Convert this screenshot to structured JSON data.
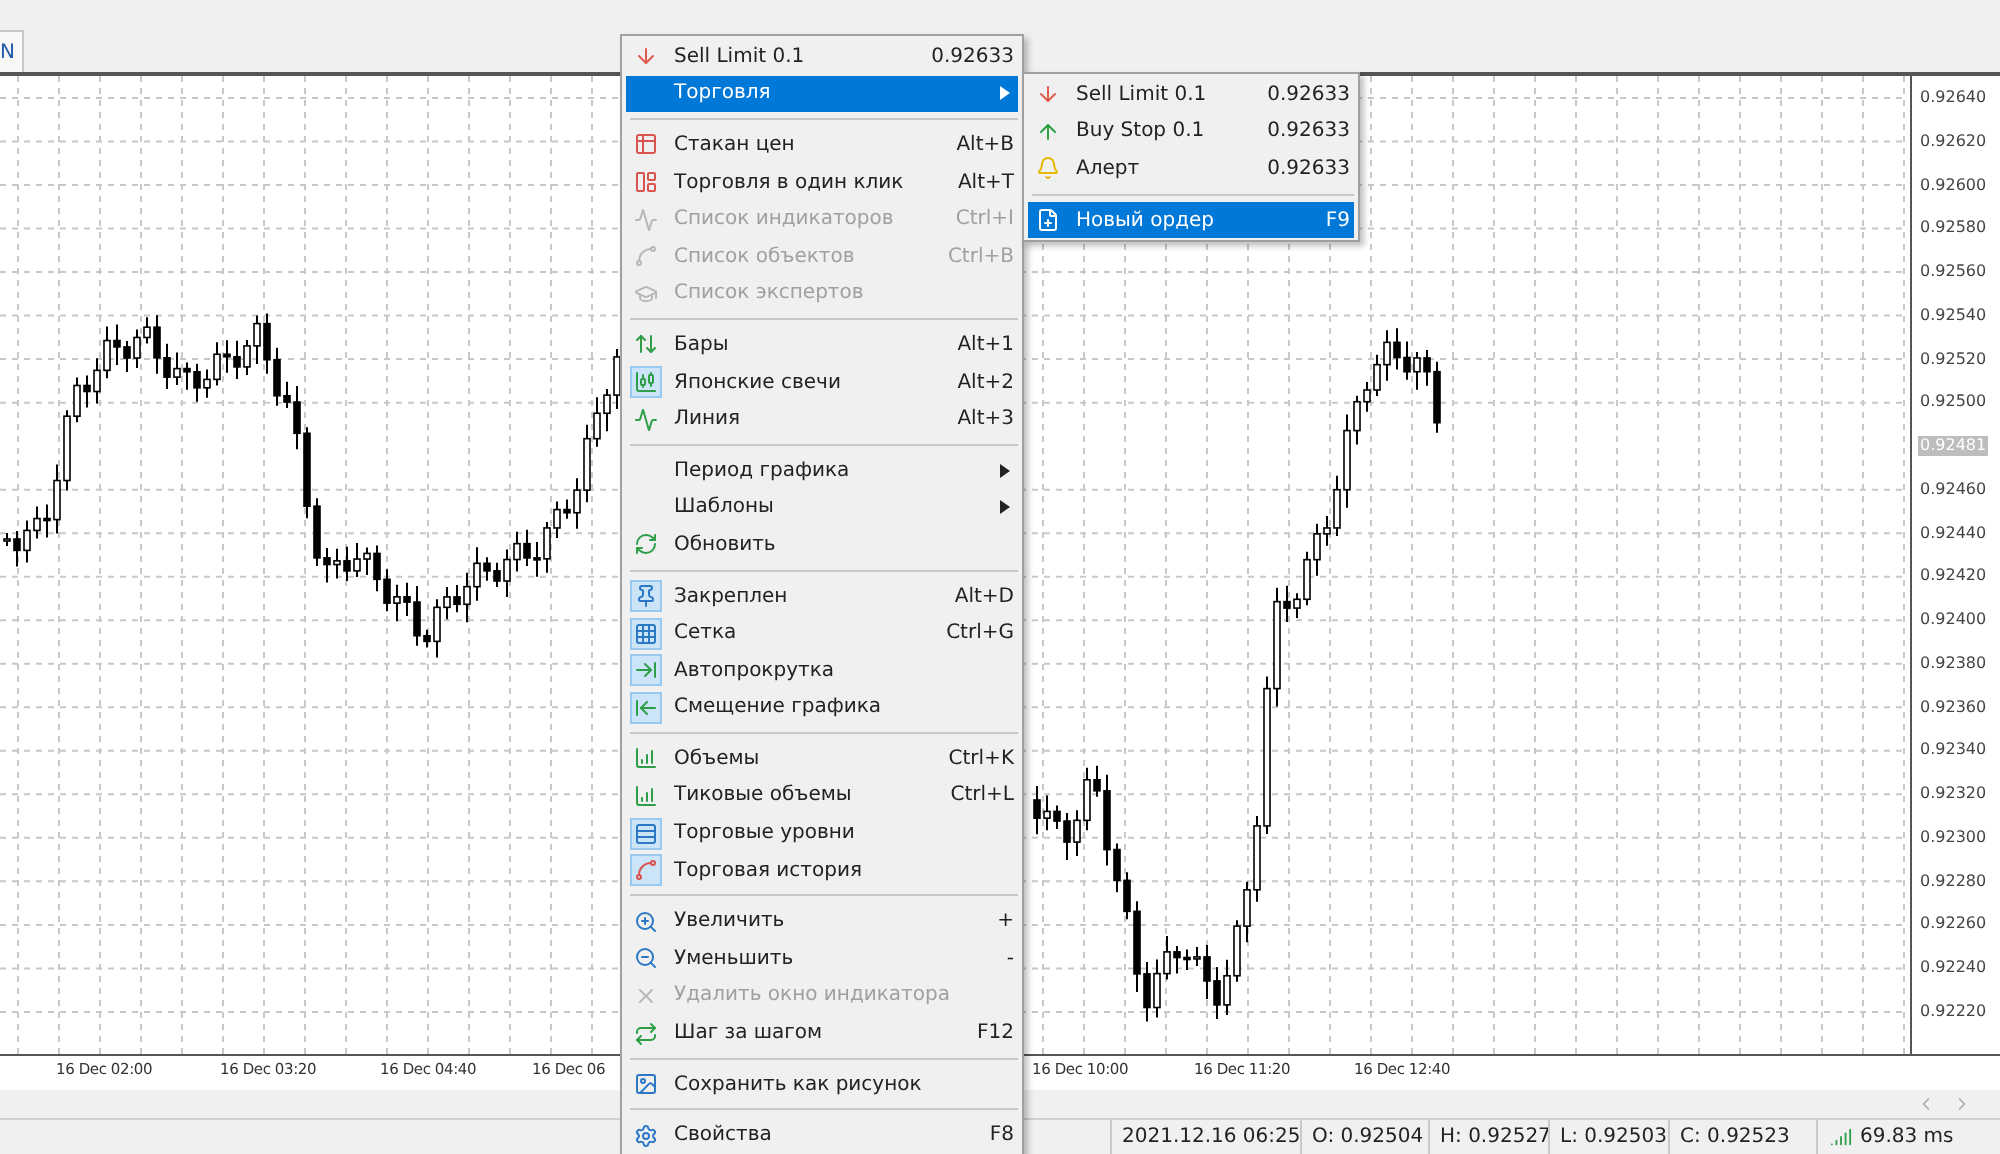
{
  "toolbar": {
    "tab": "N"
  },
  "chart": {
    "price_labels": [
      {
        "kind": "tick",
        "text": "0.92640"
      },
      {
        "kind": "tick",
        "text": "0.92620"
      },
      {
        "kind": "tick",
        "text": "0.92600"
      },
      {
        "kind": "tick",
        "text": "0.92580"
      },
      {
        "kind": "tick",
        "text": "0.92560"
      },
      {
        "kind": "tick",
        "text": "0.92540"
      },
      {
        "kind": "tick",
        "text": "0.92520"
      },
      {
        "kind": "tick",
        "text": "0.92500"
      },
      {
        "kind": "current",
        "text": "0.92481"
      },
      {
        "kind": "tick",
        "text": "0.92460"
      },
      {
        "kind": "tick",
        "text": "0.92440"
      },
      {
        "kind": "tick",
        "text": "0.92420"
      },
      {
        "kind": "tick",
        "text": "0.92400"
      },
      {
        "kind": "tick",
        "text": "0.92380"
      },
      {
        "kind": "tick",
        "text": "0.92360"
      },
      {
        "kind": "tick",
        "text": "0.92340"
      },
      {
        "kind": "tick",
        "text": "0.92320"
      },
      {
        "kind": "tick",
        "text": "0.92300"
      },
      {
        "kind": "tick",
        "text": "0.92280"
      },
      {
        "kind": "tick",
        "text": "0.92260"
      },
      {
        "kind": "tick",
        "text": "0.92240"
      },
      {
        "kind": "tick",
        "text": "0.92220"
      }
    ],
    "time_labels": [
      "16 Dec 02:00",
      "16 Dec 03:20",
      "16 Dec 04:40",
      "16 Dec 06",
      "16 Dec 10:00",
      "16 Dec 11:20",
      "16 Dec 12:40"
    ]
  },
  "context_menu": {
    "items": [
      {
        "kind": "item",
        "label": "Sell Limit 0.1",
        "shortcut": "0.92633",
        "selected": false,
        "disabled": false,
        "checked": false,
        "submenu": false
      },
      {
        "kind": "item",
        "label": "Торговля",
        "selected": true,
        "disabled": false,
        "checked": false,
        "submenu": true
      },
      {
        "kind": "separator"
      },
      {
        "kind": "item",
        "label": "Стакан цен",
        "shortcut": "Alt+B",
        "selected": false,
        "disabled": false,
        "checked": false,
        "submenu": false
      },
      {
        "kind": "item",
        "label": "Торговля в один клик",
        "shortcut": "Alt+T",
        "selected": false,
        "disabled": false,
        "checked": false,
        "submenu": false
      },
      {
        "kind": "item",
        "label": "Список индикаторов",
        "shortcut": "Ctrl+I",
        "selected": false,
        "disabled": true,
        "checked": false,
        "submenu": false
      },
      {
        "kind": "item",
        "label": "Список объектов",
        "shortcut": "Ctrl+B",
        "selected": false,
        "disabled": true,
        "checked": false,
        "submenu": false
      },
      {
        "kind": "item",
        "label": "Список экспертов",
        "selected": false,
        "disabled": true,
        "checked": false,
        "submenu": false
      },
      {
        "kind": "separator"
      },
      {
        "kind": "item",
        "label": "Бары",
        "shortcut": "Alt+1",
        "selected": false,
        "disabled": false,
        "checked": false,
        "submenu": false
      },
      {
        "kind": "item",
        "label": "Японские свечи",
        "shortcut": "Alt+2",
        "selected": false,
        "disabled": false,
        "checked": true,
        "submenu": false
      },
      {
        "kind": "item",
        "label": "Линия",
        "shortcut": "Alt+3",
        "selected": false,
        "disabled": false,
        "checked": false,
        "submenu": false
      },
      {
        "kind": "separator"
      },
      {
        "kind": "item",
        "label": "Период графика",
        "selected": false,
        "disabled": false,
        "checked": false,
        "submenu": true
      },
      {
        "kind": "item",
        "label": "Шаблоны",
        "selected": false,
        "disabled": false,
        "checked": false,
        "submenu": true
      },
      {
        "kind": "item",
        "label": "Обновить",
        "selected": false,
        "disabled": false,
        "checked": false,
        "submenu": false
      },
      {
        "kind": "separator"
      },
      {
        "kind": "item",
        "label": "Закреплен",
        "shortcut": "Alt+D",
        "selected": false,
        "disabled": false,
        "checked": true,
        "submenu": false
      },
      {
        "kind": "item",
        "label": "Сетка",
        "shortcut": "Ctrl+G",
        "selected": false,
        "disabled": false,
        "checked": true,
        "submenu": false
      },
      {
        "kind": "item",
        "label": "Автопрокрутка",
        "selected": false,
        "disabled": false,
        "checked": true,
        "submenu": false
      },
      {
        "kind": "item",
        "label": "Смещение графика",
        "selected": false,
        "disabled": false,
        "checked": true,
        "submenu": false
      },
      {
        "kind": "separator"
      },
      {
        "kind": "item",
        "label": "Объемы",
        "shortcut": "Ctrl+K",
        "selected": false,
        "disabled": false,
        "checked": false,
        "submenu": false
      },
      {
        "kind": "item",
        "label": "Тиковые объемы",
        "shortcut": "Ctrl+L",
        "selected": false,
        "disabled": false,
        "checked": false,
        "submenu": false
      },
      {
        "kind": "item",
        "label": "Торговые уровни",
        "selected": false,
        "disabled": false,
        "checked": true,
        "submenu": false
      },
      {
        "kind": "item",
        "label": "Торговая история",
        "selected": false,
        "disabled": false,
        "checked": true,
        "submenu": false
      },
      {
        "kind": "separator"
      },
      {
        "kind": "item",
        "label": "Увеличить",
        "shortcut": "+",
        "selected": false,
        "disabled": false,
        "checked": false,
        "submenu": false
      },
      {
        "kind": "item",
        "label": "Уменьшить",
        "shortcut": "-",
        "selected": false,
        "disabled": false,
        "checked": false,
        "submenu": false
      },
      {
        "kind": "item",
        "label": "Удалить окно индикатора",
        "selected": false,
        "disabled": true,
        "checked": false,
        "submenu": false
      },
      {
        "kind": "item",
        "label": "Шаг за шагом",
        "shortcut": "F12",
        "selected": false,
        "disabled": false,
        "checked": false,
        "submenu": false
      },
      {
        "kind": "separator"
      },
      {
        "kind": "item",
        "label": "Сохранить как рисунок",
        "selected": false,
        "disabled": false,
        "checked": false,
        "submenu": false
      },
      {
        "kind": "separator"
      },
      {
        "kind": "item",
        "label": "Свойства",
        "shortcut": "F8",
        "selected": false,
        "disabled": false,
        "checked": false,
        "submenu": false
      }
    ]
  },
  "submenu": {
    "items": [
      {
        "kind": "item",
        "label": "Sell Limit 0.1",
        "shortcut": "0.92633",
        "selected": false,
        "disabled": false,
        "checked": false,
        "submenu": false
      },
      {
        "kind": "item",
        "label": "Buy Stop 0.1",
        "shortcut": "0.92633",
        "selected": false,
        "disabled": false,
        "checked": false,
        "submenu": false
      },
      {
        "kind": "item",
        "label": "Алерт",
        "shortcut": "0.92633",
        "selected": false,
        "disabled": false,
        "checked": false,
        "submenu": false
      },
      {
        "kind": "separator"
      },
      {
        "kind": "item",
        "label": "Новый ордер",
        "shortcut": "F9",
        "selected": true,
        "disabled": false,
        "checked": false,
        "submenu": false
      }
    ]
  },
  "status_bar": {
    "datetime": "2021.12.16 06:25",
    "open": "O: 0.92504",
    "high": "H: 0.92527",
    "low": "L: 0.92503",
    "close": "C: 0.92523",
    "ping": "69.83 ms"
  }
}
